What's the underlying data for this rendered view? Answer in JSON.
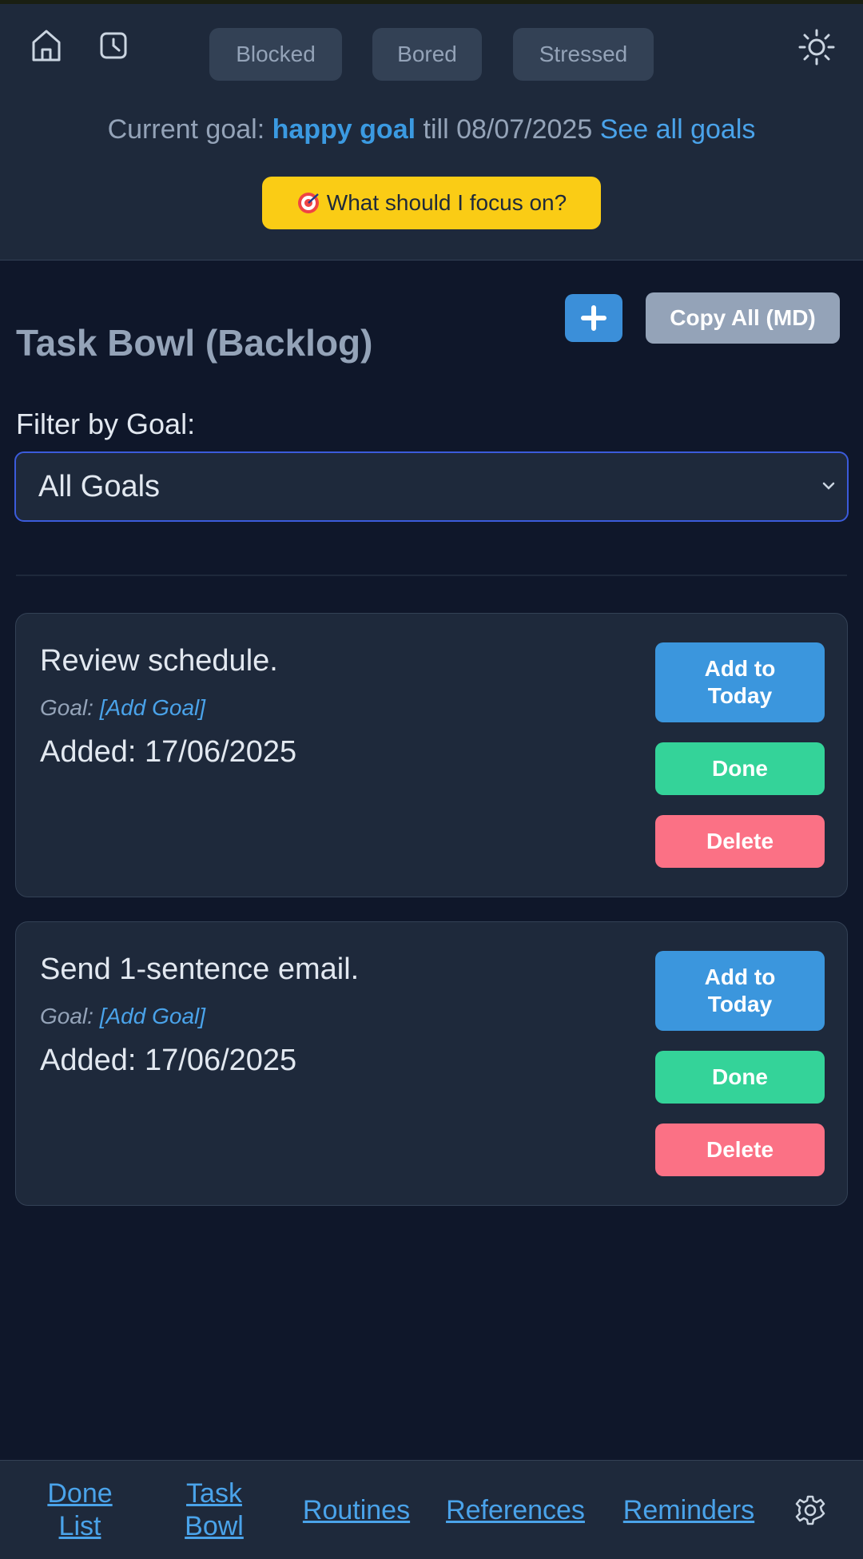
{
  "header": {
    "icons": {
      "home": "home-icon",
      "clock": "clock-icon",
      "theme": "sun-icon"
    },
    "moods": [
      "Blocked",
      "Bored",
      "Stressed"
    ],
    "goal": {
      "prefix": "Current goal:",
      "name": "happy goal",
      "till": "till 08/07/2025",
      "see_all": "See all goals"
    },
    "focus_button": {
      "icon": "target-icon",
      "label": "What should I focus on?"
    },
    "colors": {
      "focus": "#facc15",
      "accent": "#3b9ae1"
    }
  },
  "main": {
    "title": "Task Bowl (Backlog)",
    "add_button_icon": "plus-icon",
    "copy_button": "Copy All (MD)",
    "filter": {
      "label": "Filter by Goal:",
      "selected": "All Goals"
    },
    "tasks": [
      {
        "title": "Review schedule.",
        "goal_label": "Goal:",
        "goal_link": "[Add Goal]",
        "added": "Added: 17/06/2025",
        "buttons": {
          "today": "Add to Today",
          "done": "Done",
          "delete": "Delete"
        }
      },
      {
        "title": "Send 1-sentence email.",
        "goal_label": "Goal:",
        "goal_link": "[Add Goal]",
        "added": "Added: 17/06/2025",
        "buttons": {
          "today": "Add to Today",
          "done": "Done",
          "delete": "Delete"
        }
      }
    ]
  },
  "footer": {
    "links": [
      "Done List",
      "Task Bowl",
      "Routines",
      "References",
      "Reminders"
    ],
    "settings_icon": "gear-icon"
  }
}
